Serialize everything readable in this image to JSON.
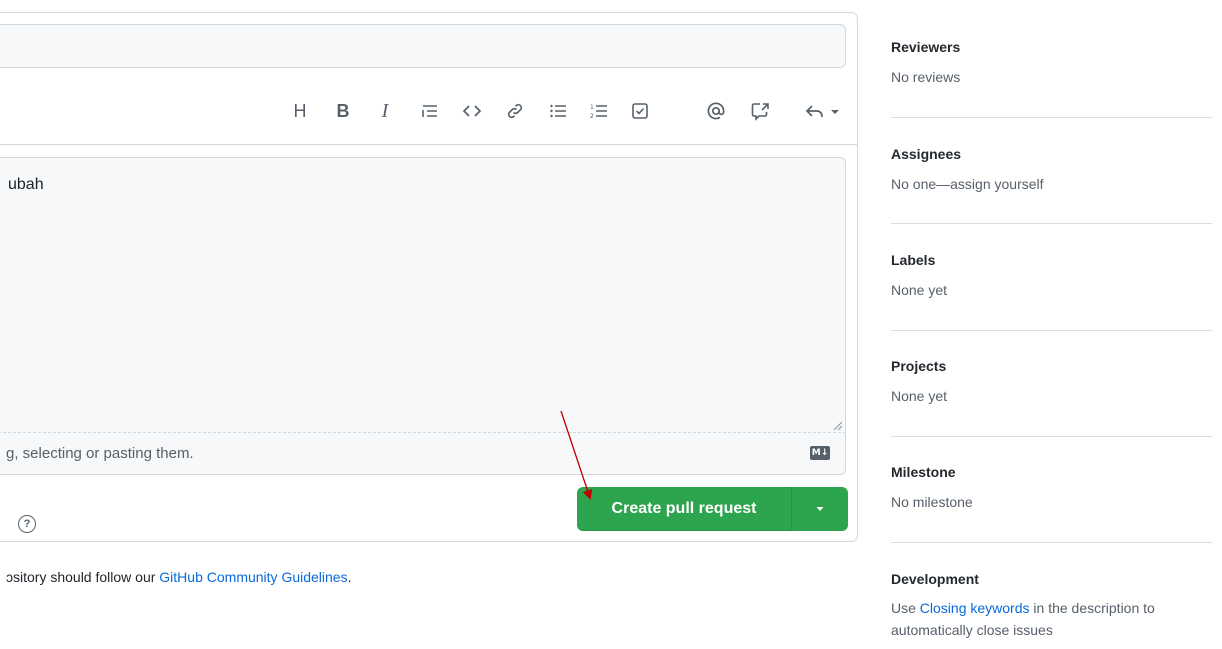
{
  "composer": {
    "title_value": "",
    "body_value": "ubah",
    "attach_hint": "g, selecting or pasting them.",
    "markdown_badge": "M↓",
    "help_icon": "?",
    "toolbar": [
      {
        "name": "heading-icon",
        "glyph": "H"
      },
      {
        "name": "bold-icon",
        "glyph": "B"
      },
      {
        "name": "italic-icon",
        "glyph": "I"
      },
      {
        "name": "quote-icon",
        "glyph": "quote"
      },
      {
        "name": "code-icon",
        "glyph": "<>"
      },
      {
        "name": "link-icon",
        "glyph": "link"
      },
      {
        "name": "unordered-list-icon",
        "glyph": "ul"
      },
      {
        "name": "ordered-list-icon",
        "glyph": "ol"
      },
      {
        "name": "task-list-icon",
        "glyph": "task"
      },
      {
        "name": "mention-icon",
        "glyph": "@"
      },
      {
        "name": "cross-reference-icon",
        "glyph": "xref"
      },
      {
        "name": "reply-icon",
        "glyph": "reply"
      }
    ]
  },
  "actions": {
    "create_pr_label": "Create pull request",
    "create_pr_color": "#2da44e"
  },
  "footer": {
    "prefix": "ɔsitory should follow our ",
    "link": "GitHub Community Guidelines",
    "suffix": "."
  },
  "sidebar": {
    "reviewers": {
      "heading": "Reviewers",
      "value": "No reviews"
    },
    "assignees": {
      "heading": "Assignees",
      "value": "No one—assign yourself"
    },
    "labels": {
      "heading": "Labels",
      "value": "None yet"
    },
    "projects": {
      "heading": "Projects",
      "value": "None yet"
    },
    "milestone": {
      "heading": "Milestone",
      "value": "No milestone"
    },
    "development": {
      "heading": "Development",
      "prefix": "Use ",
      "link": "Closing keywords",
      "suffix": " in the description to automatically close issues"
    }
  },
  "colors": {
    "link": "#0969da",
    "annotation_arrow": "#c00000"
  }
}
